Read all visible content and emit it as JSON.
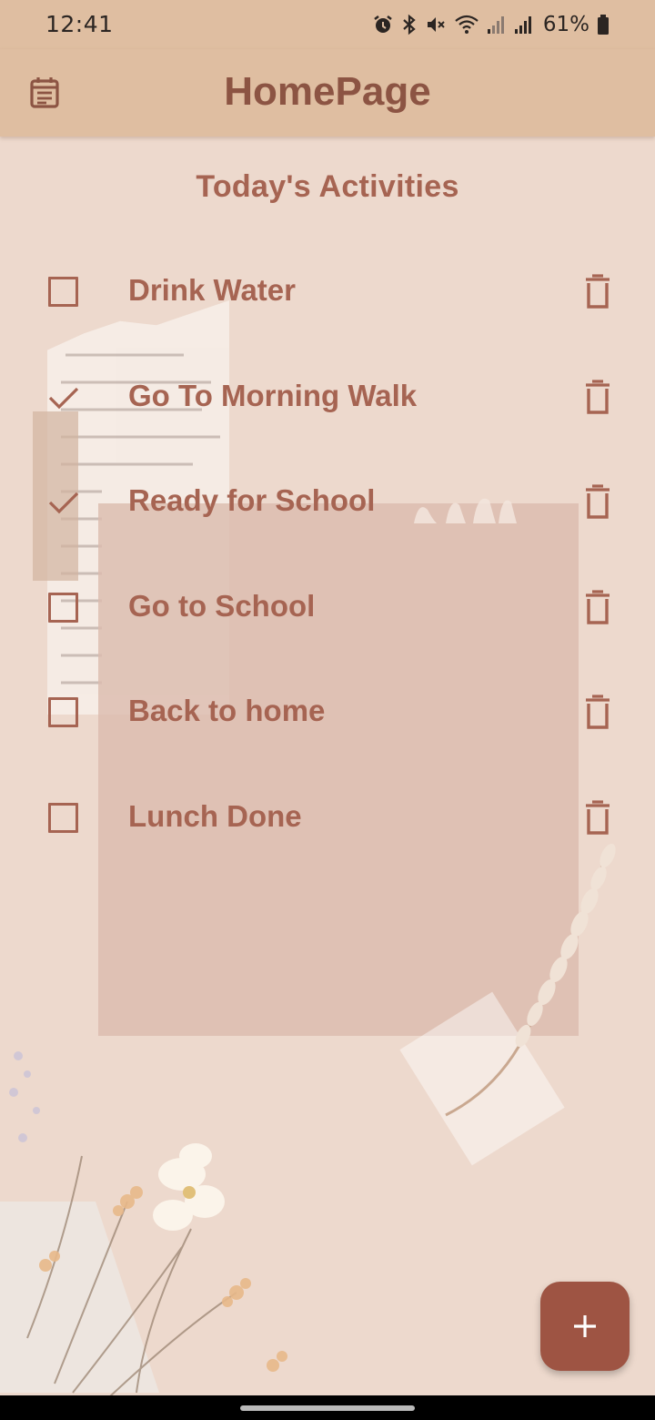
{
  "status_bar": {
    "time": "12:41",
    "battery": "61%",
    "icons": [
      "alarm-icon",
      "bluetooth-icon",
      "mute-icon",
      "wifi-icon",
      "signal-icon",
      "signal-icon",
      "battery-icon"
    ]
  },
  "app_bar": {
    "title": "HomePage",
    "leading_icon": "calendar-icon"
  },
  "section_title": "Today's Activities",
  "activities": [
    {
      "label": "Drink Water",
      "checked": false
    },
    {
      "label": "Go To Morning Walk",
      "checked": true
    },
    {
      "label": "Ready for School",
      "checked": true
    },
    {
      "label": "Go to School",
      "checked": false
    },
    {
      "label": "Back to home",
      "checked": false
    },
    {
      "label": "Lunch Done",
      "checked": false
    }
  ],
  "fab": {
    "icon": "plus-icon"
  },
  "colors": {
    "app_bar": "#dfbea1",
    "accent": "#a66452",
    "title": "#8c5443",
    "fab": "#9e5443",
    "background": "#edd9cd"
  }
}
